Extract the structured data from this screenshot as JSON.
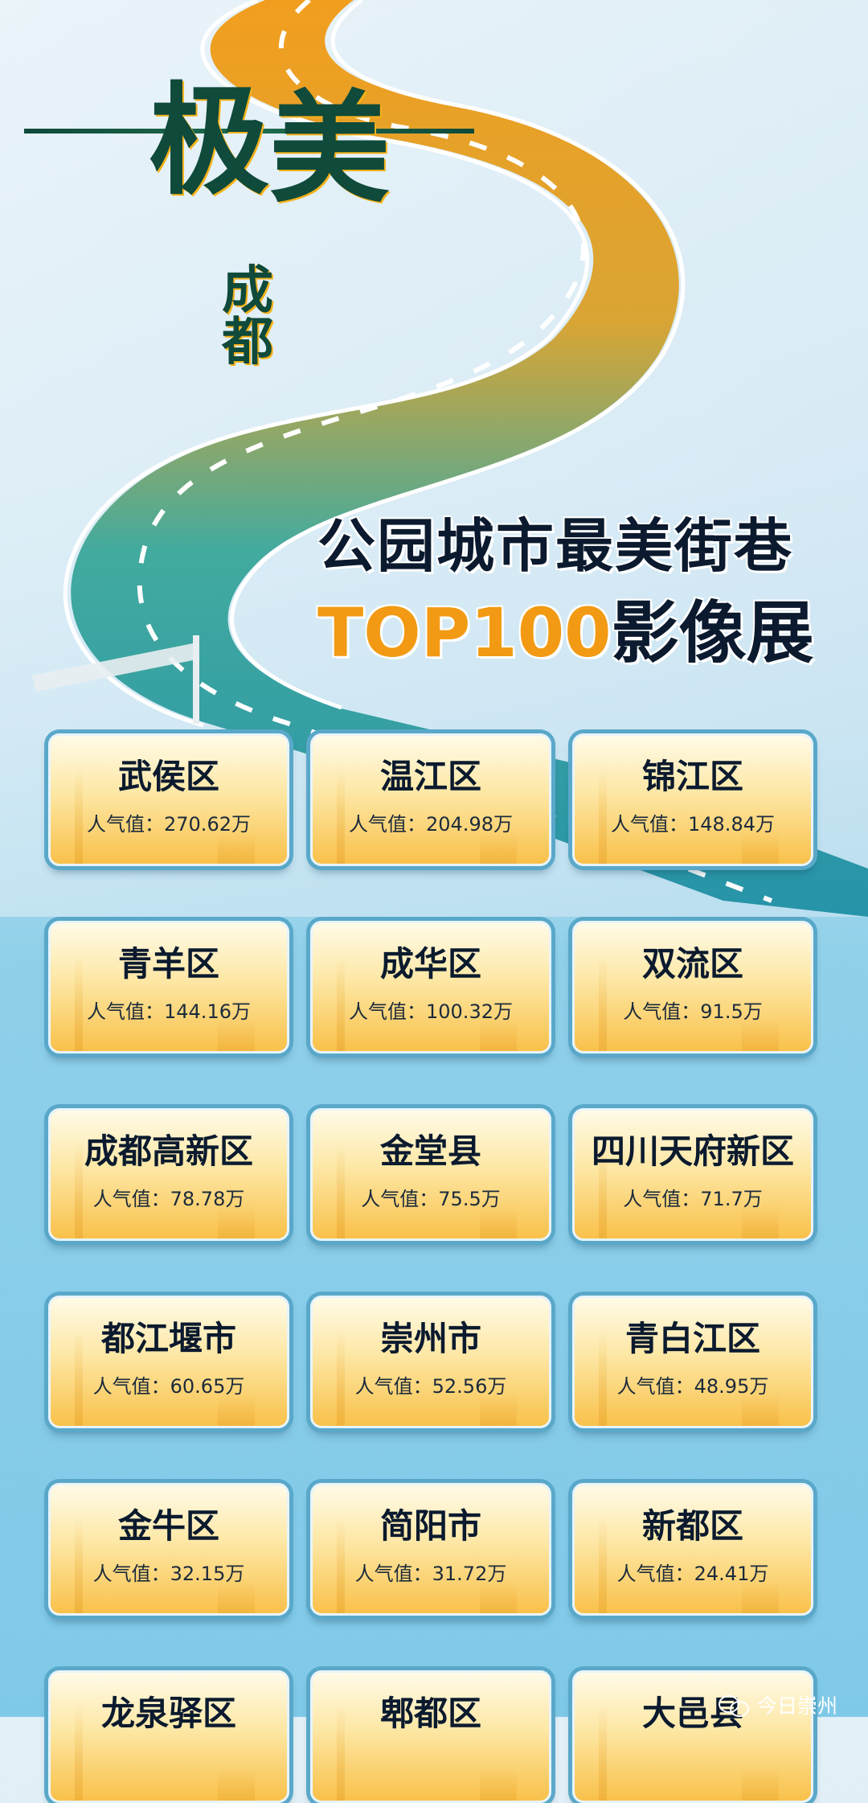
{
  "logo": {
    "line": "一",
    "ji": "极",
    "mei": "美",
    "sub": "成都"
  },
  "title": {
    "line1": "公园城市最美街巷",
    "top": "TOP100",
    "exhibition": "影像展"
  },
  "pop_prefix": "人气值：",
  "districts": [
    {
      "name": "武侯区",
      "popularity": "270.62万"
    },
    {
      "name": "温江区",
      "popularity": "204.98万"
    },
    {
      "name": "锦江区",
      "popularity": "148.84万"
    },
    {
      "name": "青羊区",
      "popularity": "144.16万"
    },
    {
      "name": "成华区",
      "popularity": "100.32万"
    },
    {
      "name": "双流区",
      "popularity": "91.5万"
    },
    {
      "name": "成都高新区",
      "popularity": "78.78万"
    },
    {
      "name": "金堂县",
      "popularity": "75.5万"
    },
    {
      "name": "四川天府新区",
      "popularity": "71.7万"
    },
    {
      "name": "都江堰市",
      "popularity": "60.65万"
    },
    {
      "name": "崇州市",
      "popularity": "52.56万"
    },
    {
      "name": "青白江区",
      "popularity": "48.95万"
    },
    {
      "name": "金牛区",
      "popularity": "32.15万"
    },
    {
      "name": "简阳市",
      "popularity": "31.72万"
    },
    {
      "name": "新都区",
      "popularity": "24.41万"
    },
    {
      "name": "龙泉驿区",
      "popularity": ""
    },
    {
      "name": "郫都区",
      "popularity": ""
    },
    {
      "name": "大邑县",
      "popularity": ""
    }
  ],
  "watermark": {
    "text": "今日崇州",
    "icon": "wechat-icon"
  },
  "colors": {
    "road_orange": "#f29a13",
    "road_teal": "#2aa6a0",
    "card_gold": "#f9c14a",
    "title_dark": "#0b1a2e"
  }
}
